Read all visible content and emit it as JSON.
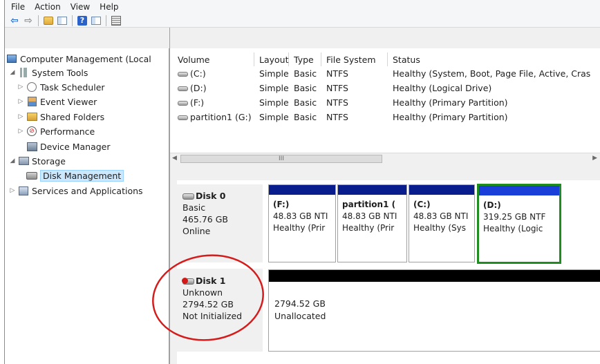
{
  "menu": [
    "File",
    "Action",
    "View",
    "Help"
  ],
  "toolbar": {
    "buttons": [
      "back-icon",
      "forward-icon",
      "up-folder-icon",
      "show-hide-tree-icon",
      "help-icon",
      "show-hide-action-pane-icon",
      "properties-icon"
    ]
  },
  "tree": {
    "root": "Computer Management (Local",
    "system_tools": "System Tools",
    "task_scheduler": "Task Scheduler",
    "event_viewer": "Event Viewer",
    "shared_folders": "Shared Folders",
    "performance": "Performance",
    "device_manager": "Device Manager",
    "storage": "Storage",
    "disk_management": "Disk Management",
    "services": "Services and Applications"
  },
  "volumes": {
    "headers": [
      "Volume",
      "Layout",
      "Type",
      "File System",
      "Status"
    ],
    "rows": [
      {
        "volume": "(C:)",
        "layout": "Simple",
        "type": "Basic",
        "fs": "NTFS",
        "status": "Healthy (System, Boot, Page File, Active, Cras"
      },
      {
        "volume": "(D:)",
        "layout": "Simple",
        "type": "Basic",
        "fs": "NTFS",
        "status": "Healthy (Logical Drive)"
      },
      {
        "volume": "(F:)",
        "layout": "Simple",
        "type": "Basic",
        "fs": "NTFS",
        "status": "Healthy (Primary Partition)"
      },
      {
        "volume": "partition1 (G:)",
        "layout": "Simple",
        "type": "Basic",
        "fs": "NTFS",
        "status": "Healthy (Primary Partition)"
      }
    ],
    "scroll_thumb": "III"
  },
  "disk0": {
    "name": "Disk 0",
    "type": "Basic",
    "size": "465.76 GB",
    "state": "Online",
    "partitions": [
      {
        "title": "(F:)",
        "size": "48.83 GB NTI",
        "status": "Healthy (Prir"
      },
      {
        "title": "partition1  (",
        "size": "48.83 GB NTI",
        "status": "Healthy (Prir"
      },
      {
        "title": "(C:)",
        "size": "48.83 GB NTI",
        "status": "Healthy (Sys"
      },
      {
        "title": "(D:)",
        "size": "319.25 GB NTF",
        "status": "Healthy (Logic"
      }
    ]
  },
  "disk1": {
    "name": "Disk 1",
    "type": "Unknown",
    "size": "2794.52 GB",
    "state": "Not Initialized",
    "unallocated_size": "2794.52 GB",
    "unallocated_label": "Unallocated"
  },
  "colors": {
    "partition_bar": "#0a1d8c",
    "selected_border": "#1e8c1e",
    "unallocated_bar": "#000000",
    "annotation_circle": "#d41c1c"
  }
}
